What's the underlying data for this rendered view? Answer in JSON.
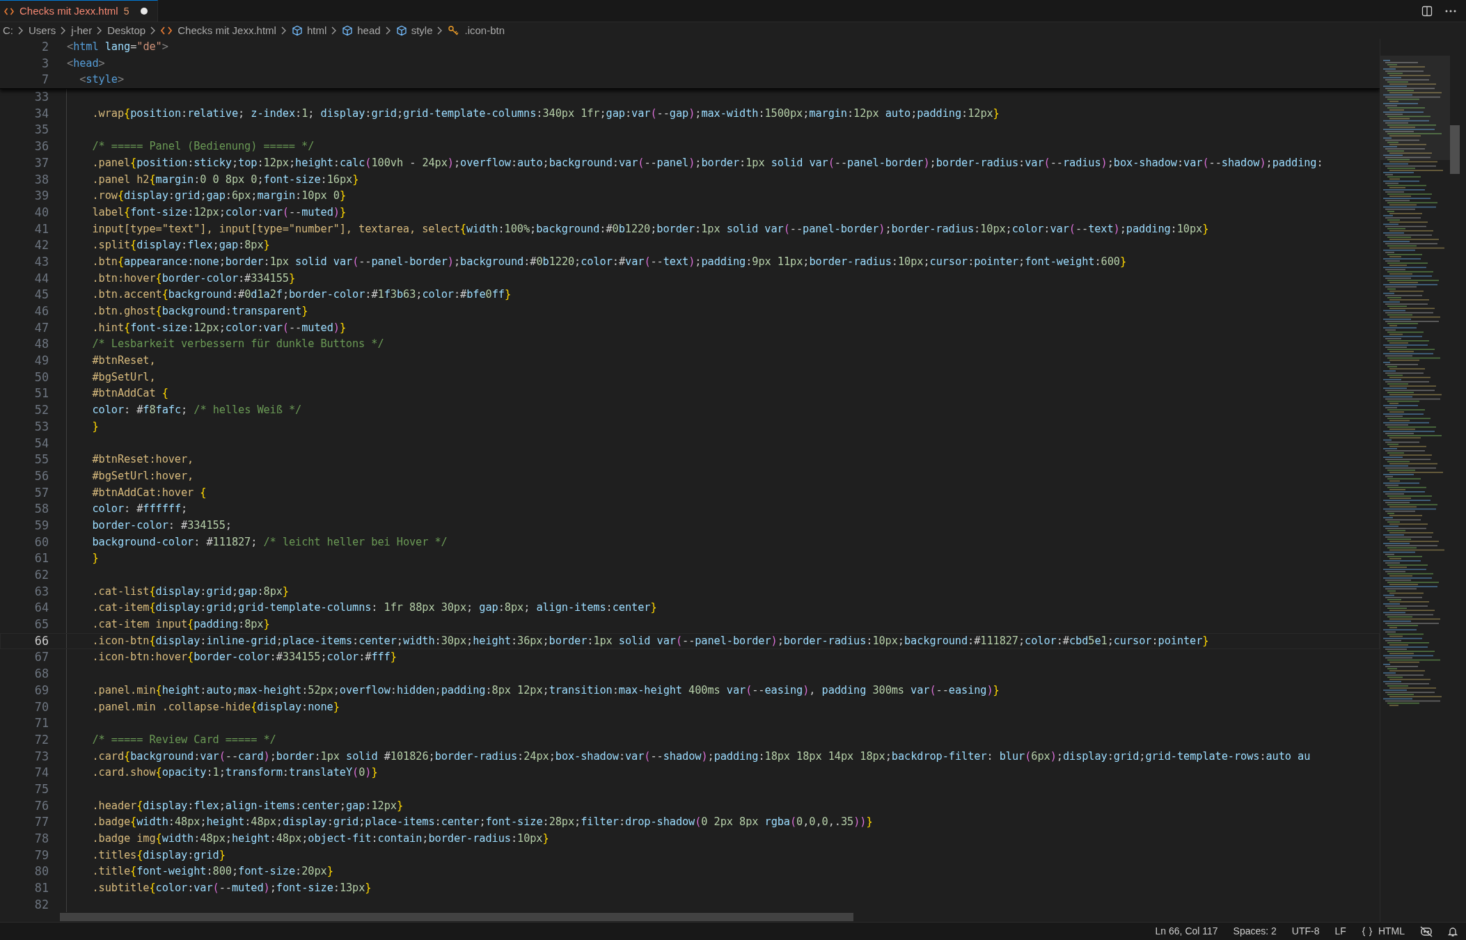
{
  "tab": {
    "title": "Checks mit Jexx.html",
    "problems": "5",
    "modified": true
  },
  "breadcrumbs": [
    {
      "kind": "folder",
      "label": "C:"
    },
    {
      "kind": "folder",
      "label": "Users"
    },
    {
      "kind": "folder",
      "label": "j-her"
    },
    {
      "kind": "folder",
      "label": "Desktop"
    },
    {
      "kind": "file",
      "label": "Checks mit Jexx.html"
    },
    {
      "kind": "element",
      "label": "html"
    },
    {
      "kind": "element",
      "label": "head"
    },
    {
      "kind": "element",
      "label": "style"
    },
    {
      "kind": "rule",
      "label": ".icon-btn"
    }
  ],
  "sticky_lines": [
    {
      "number": "2",
      "text": "<html lang=\"de\">"
    },
    {
      "number": "3",
      "text": "<head>"
    },
    {
      "number": "7",
      "text": "  <style>"
    }
  ],
  "lines": [
    {
      "number": "33",
      "current": false
    },
    {
      "number": "34",
      "text": "    .wrap{position:relative; z-index:1; display:grid;grid-template-columns:340px 1fr;gap:var(--gap);max-width:1500px;margin:12px auto;padding:12px}",
      "current": false
    },
    {
      "number": "35",
      "current": false
    },
    {
      "number": "36",
      "text": "    /* ===== Panel (Bedienung) ===== */",
      "current": false
    },
    {
      "number": "37",
      "text": "    .panel{position:sticky;top:12px;height:calc(100vh - 24px);overflow:auto;background:var(--panel);border:1px solid var(--panel-border);border-radius:var(--radius);box-shadow:var(--shadow);padding:",
      "current": false
    },
    {
      "number": "38",
      "text": "    .panel h2{margin:0 0 8px 0;font-size:16px}",
      "current": false
    },
    {
      "number": "39",
      "text": "    .row{display:grid;gap:6px;margin:10px 0}",
      "current": false
    },
    {
      "number": "40",
      "text": "    label{font-size:12px;color:var(--muted)}",
      "current": false
    },
    {
      "number": "41",
      "text": "    input[type=\"text\"], input[type=\"number\"], textarea, select{width:100%;background:#0b1220;border:1px solid var(--panel-border);border-radius:10px;color:var(--text);padding:10px}",
      "current": false
    },
    {
      "number": "42",
      "text": "    .split{display:flex;gap:8px}",
      "current": false
    },
    {
      "number": "43",
      "text": "    .btn{appearance:none;border:1px solid var(--panel-border);background:#0b1220;color:#var(--text);padding:9px 11px;border-radius:10px;cursor:pointer;font-weight:600}",
      "current": false
    },
    {
      "number": "44",
      "text": "    .btn:hover{border-color:#334155}",
      "current": false
    },
    {
      "number": "45",
      "text": "    .btn.accent{background:#0d1a2f;border-color:#1f3b63;color:#bfe0ff}",
      "current": false
    },
    {
      "number": "46",
      "text": "    .btn.ghost{background:transparent}",
      "current": false
    },
    {
      "number": "47",
      "text": "    .hint{font-size:12px;color:var(--muted)}",
      "current": false
    },
    {
      "number": "48",
      "text": "    /* Lesbarkeit verbessern für dunkle Buttons */",
      "current": false
    },
    {
      "number": "49",
      "text": "    #btnReset,",
      "current": false
    },
    {
      "number": "50",
      "text": "    #bgSetUrl,",
      "current": false
    },
    {
      "number": "51",
      "text": "    #btnAddCat {",
      "current": false
    },
    {
      "number": "52",
      "text": "    color: #f8fafc; /* helles Weiß */",
      "current": false
    },
    {
      "number": "53",
      "text": "    }",
      "current": false
    },
    {
      "number": "54",
      "current": false
    },
    {
      "number": "55",
      "text": "    #btnReset:hover,",
      "current": false
    },
    {
      "number": "56",
      "text": "    #bgSetUrl:hover,",
      "current": false
    },
    {
      "number": "57",
      "text": "    #btnAddCat:hover {",
      "current": false
    },
    {
      "number": "58",
      "text": "    color: #ffffff;",
      "current": false
    },
    {
      "number": "59",
      "text": "    border-color: #334155;",
      "current": false
    },
    {
      "number": "60",
      "text": "    background-color: #111827; /* leicht heller bei Hover */",
      "current": false
    },
    {
      "number": "61",
      "text": "    }",
      "current": false
    },
    {
      "number": "62",
      "current": false
    },
    {
      "number": "63",
      "text": "    .cat-list{display:grid;gap:8px}",
      "current": false
    },
    {
      "number": "64",
      "text": "    .cat-item{display:grid;grid-template-columns: 1fr 88px 30px; gap:8px; align-items:center}",
      "current": false
    },
    {
      "number": "65",
      "text": "    .cat-item input{padding:8px}",
      "current": false
    },
    {
      "number": "66",
      "text": "    .icon-btn{display:inline-grid;place-items:center;width:30px;height:36px;border:1px solid var(--panel-border);border-radius:10px;background:#111827;color:#cbd5e1;cursor:pointer}",
      "current": true
    },
    {
      "number": "67",
      "text": "    .icon-btn:hover{border-color:#334155;color:#fff}",
      "current": false
    },
    {
      "number": "68",
      "current": false
    },
    {
      "number": "69",
      "text": "    .panel.min{height:auto;max-height:52px;overflow:hidden;padding:8px 12px;transition:max-height 400ms var(--easing), padding 300ms var(--easing)}",
      "current": false
    },
    {
      "number": "70",
      "text": "    .panel.min .collapse-hide{display:none}",
      "current": false
    },
    {
      "number": "71",
      "current": false
    },
    {
      "number": "72",
      "text": "    /* ===== Review Card ===== */",
      "current": false
    },
    {
      "number": "73",
      "text": "    .card{background:var(--card);border:1px solid #101826;border-radius:24px;box-shadow:var(--shadow);padding:18px 18px 14px 18px;backdrop-filter: blur(6px);display:grid;grid-template-rows:auto au",
      "current": false
    },
    {
      "number": "74",
      "text": "    .card.show{opacity:1;transform:translateY(0)}",
      "current": false
    },
    {
      "number": "75",
      "current": false
    },
    {
      "number": "76",
      "text": "    .header{display:flex;align-items:center;gap:12px}",
      "current": false
    },
    {
      "number": "77",
      "text": "    .badge{width:48px;height:48px;display:grid;place-items:center;font-size:28px;filter:drop-shadow(0 2px 8px rgba(0,0,0,.35))}",
      "current": false
    },
    {
      "number": "78",
      "text": "    .badge img{width:48px;height:48px;object-fit:contain;border-radius:10px}",
      "current": false
    },
    {
      "number": "79",
      "text": "    .titles{display:grid}",
      "current": false
    },
    {
      "number": "80",
      "text": "    .title{font-weight:800;font-size:20px}",
      "current": false
    },
    {
      "number": "81",
      "text": "    .subtitle{color:var(--muted);font-size:13px}",
      "current": false
    },
    {
      "number": "82",
      "current": false
    }
  ],
  "status_bar": {
    "position": "Ln 66, Col 117",
    "indentation": "Spaces: 2",
    "encoding": "UTF-8",
    "line_ending": "LF",
    "language": "HTML"
  }
}
